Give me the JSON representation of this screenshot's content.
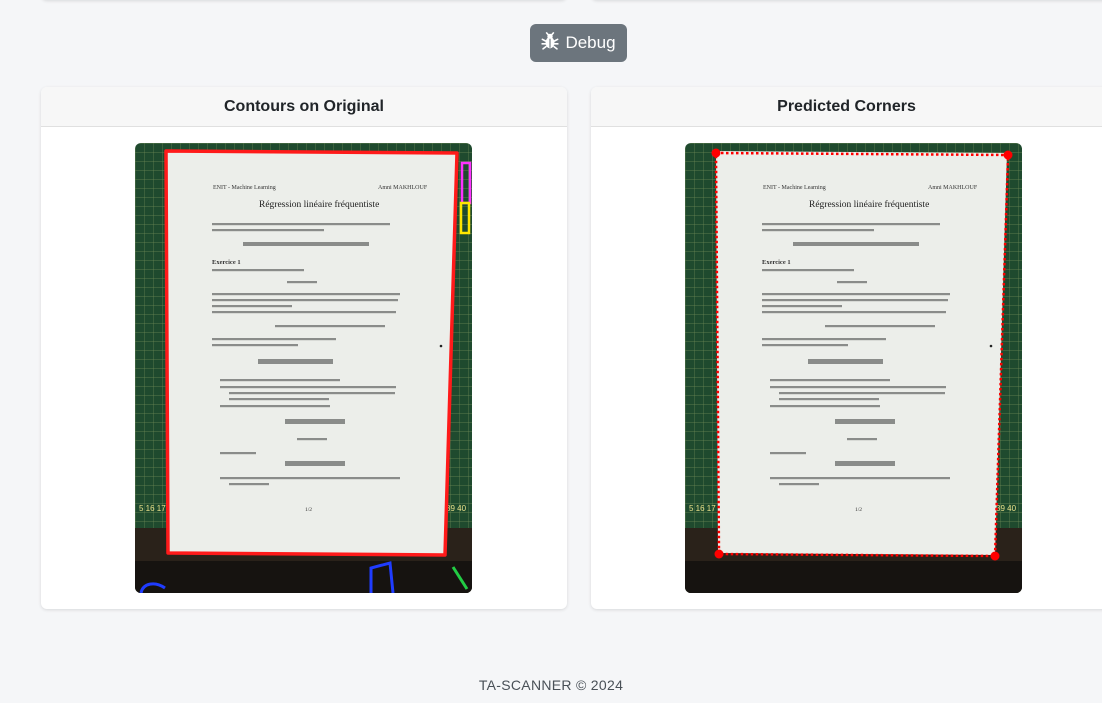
{
  "debug_button": {
    "label": "Debug",
    "icon": "bug-icon"
  },
  "cards": [
    {
      "title": "Contours on Original"
    },
    {
      "title": "Predicted Corners"
    }
  ],
  "document": {
    "header_left": "ENIT - Machine Learning",
    "header_right": "Amni MAKHLOUF",
    "title": "Régression linéaire fréquentiste",
    "section": "Exercice 1",
    "page_number": "1/2"
  },
  "footer": {
    "text": "TA-SCANNER © 2024"
  },
  "colors": {
    "contour_red": "#ff1a1a",
    "contour_blue": "#1f3cff",
    "contour_yellow": "#ffe600",
    "contour_magenta": "#ff33ff",
    "contour_green": "#22cc44",
    "corner_marker": "#ff0000",
    "button_bg": "#6c757d"
  }
}
